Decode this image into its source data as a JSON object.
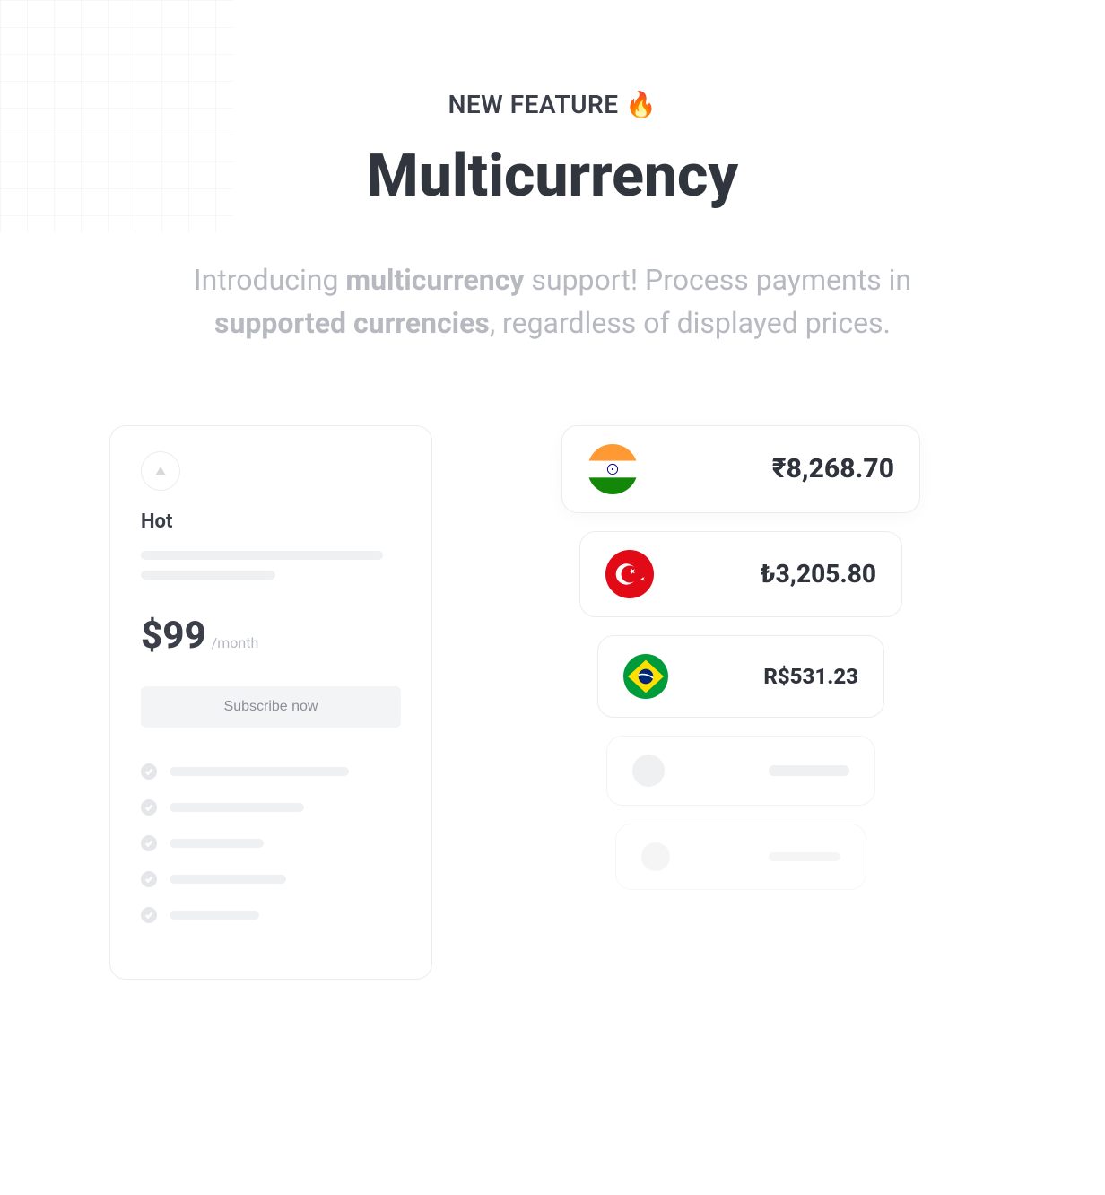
{
  "header": {
    "eyebrow": "NEW FEATURE",
    "emoji": "🔥",
    "title": "Multicurrency",
    "subtitle_parts": {
      "p1": "Introducing ",
      "b1": "multicurrency",
      "p2": " support! Process payments in ",
      "b2": "supported currencies",
      "p3": ", regardless of displayed prices."
    }
  },
  "plan": {
    "name": "Hot",
    "price": "$99",
    "period": "/month",
    "cta": "Subscribe now",
    "feature_widths": [
      200,
      150,
      105,
      130,
      100
    ]
  },
  "currencies": [
    {
      "country": "india",
      "amount": "₹8,268.70"
    },
    {
      "country": "turkey",
      "amount": "₺3,205.80"
    },
    {
      "country": "brazil",
      "amount": "R$531.23"
    }
  ]
}
